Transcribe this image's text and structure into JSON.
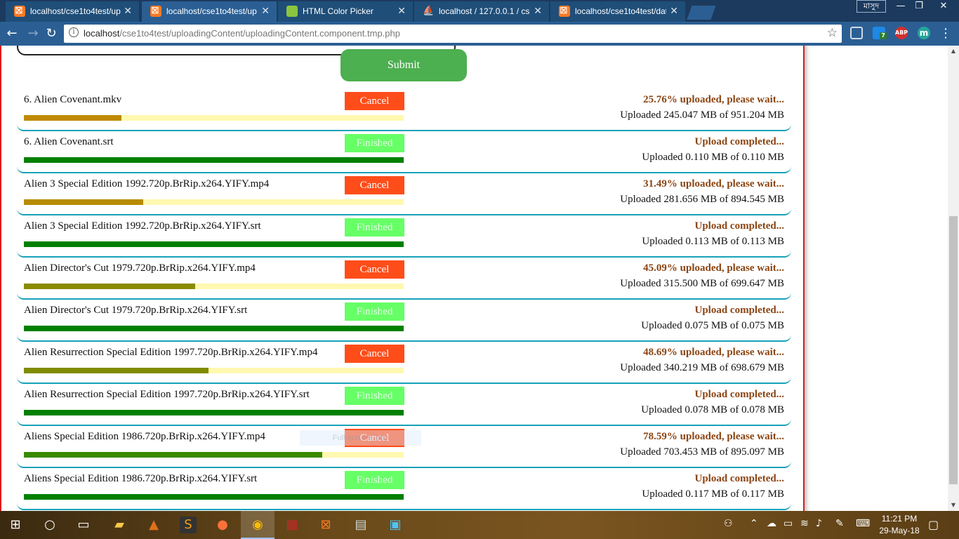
{
  "browser": {
    "tabs": [
      {
        "title": "localhost/cse1to4test/up",
        "favicon": "xampp-icon",
        "active": false
      },
      {
        "title": "localhost/cse1to4test/up",
        "favicon": "xampp-icon",
        "active": true
      },
      {
        "title": "HTML Color Picker",
        "favicon": "html-color-picker-icon",
        "active": false
      },
      {
        "title": "localhost / 127.0.0.1 / cse",
        "favicon": "phpmyadmin-icon",
        "active": false
      },
      {
        "title": "localhost/cse1to4test/dat",
        "favicon": "xampp-icon",
        "active": false
      }
    ],
    "tab_close_glyph": "✕",
    "user_label": "মাসুদ",
    "address": {
      "host": "localhost",
      "path": "/cse1to4test/uploadingContent/uploadingContent.component.tmp.php"
    },
    "extensions": [
      {
        "name": "cast-icon",
        "label": ""
      },
      {
        "name": "extension-badge-icon",
        "label": "7"
      },
      {
        "name": "adblock-plus-icon",
        "label": "ABP"
      },
      {
        "name": "profile-m-icon",
        "label": "m"
      }
    ]
  },
  "page": {
    "submit_label": "Submit",
    "uploads": [
      {
        "file": "6. Alien Covenant.mkv",
        "button": "Cancel",
        "state": "uploading",
        "progress": 25.76,
        "status": "25.76% uploaded, please wait...",
        "sizes": "Uploaded 245.047 MB of 951.204 MB",
        "fill_color": "#c08a00"
      },
      {
        "file": "6. Alien Covenant.srt",
        "button": "Finished",
        "state": "finished",
        "progress": 100,
        "status": "Upload completed...",
        "sizes": "Uploaded 0.110 MB of 0.110 MB",
        "fill_color": "#008000"
      },
      {
        "file": "Alien 3 Special Edition 1992.720p.BrRip.x264.YIFY.mp4",
        "button": "Cancel",
        "state": "uploading",
        "progress": 31.49,
        "status": "31.49% uploaded, please wait...",
        "sizes": "Uploaded 281.656 MB of 894.545 MB",
        "fill_color": "#b88c00"
      },
      {
        "file": "Alien 3 Special Edition 1992.720p.BrRip.x264.YIFY.srt",
        "button": "Finished",
        "state": "finished",
        "progress": 100,
        "status": "Upload completed...",
        "sizes": "Uploaded 0.113 MB of 0.113 MB",
        "fill_color": "#008000"
      },
      {
        "file": "Alien Director's Cut 1979.720p.BrRip.x264.YIFY.mp4",
        "button": "Cancel",
        "state": "uploading",
        "progress": 45.09,
        "status": "45.09% uploaded, please wait...",
        "sizes": "Uploaded 315.500 MB of 699.647 MB",
        "fill_color": "#8b8b00"
      },
      {
        "file": "Alien Director's Cut 1979.720p.BrRip.x264.YIFY.srt",
        "button": "Finished",
        "state": "finished",
        "progress": 100,
        "status": "Upload completed...",
        "sizes": "Uploaded 0.075 MB of 0.075 MB",
        "fill_color": "#008000"
      },
      {
        "file": "Alien Resurrection Special Edition 1997.720p.BrRip.x264.YIFY.mp4",
        "button": "Cancel",
        "state": "uploading",
        "progress": 48.69,
        "status": "48.69% uploaded, please wait...",
        "sizes": "Uploaded 340.219 MB of 698.679 MB",
        "fill_color": "#7f8c00"
      },
      {
        "file": "Alien Resurrection Special Edition 1997.720p.BrRip.x264.YIFY.srt",
        "button": "Finished",
        "state": "finished",
        "progress": 100,
        "status": "Upload completed...",
        "sizes": "Uploaded 0.078 MB of 0.078 MB",
        "fill_color": "#008000"
      },
      {
        "file": "Aliens Special Edition 1986.720p.BrRip.x264.YIFY.mp4",
        "button": "Cancel",
        "state": "uploading",
        "progress": 78.59,
        "status": "78.59% uploaded, please wait...",
        "sizes": "Uploaded 703.453 MB of 895.097 MB",
        "fill_color": "#3a8a00"
      },
      {
        "file": "Aliens Special Edition 1986.720p.BrRip.x264.YIFY.srt",
        "button": "Finished",
        "state": "finished",
        "progress": 100,
        "status": "Upload completed...",
        "sizes": "Uploaded 0.117 MB of 0.117 MB",
        "fill_color": "#008000"
      }
    ],
    "snip_overlay": "Full-screen Snip"
  },
  "colors": {
    "panel_border": "#e01c1c",
    "row_divider": "#17a2b8",
    "submit_bg": "#4caf50",
    "cancel_bg": "#ff4d1a",
    "finished_bg": "#66ff66",
    "status_text": "#8b4513",
    "track_bg": "#fff8b0"
  },
  "taskbar": {
    "pinned": [
      "windows-start-icon",
      "cortana-search-icon",
      "task-view-icon",
      "file-explorer-icon",
      "matlab-icon",
      "sublime-text-icon",
      "firefox-icon",
      "chrome-icon",
      "winrar-icon",
      "xampp-icon",
      "disk-utility-icon",
      "photos-icon"
    ],
    "time": "11:21 PM",
    "date": "29-May-18"
  }
}
